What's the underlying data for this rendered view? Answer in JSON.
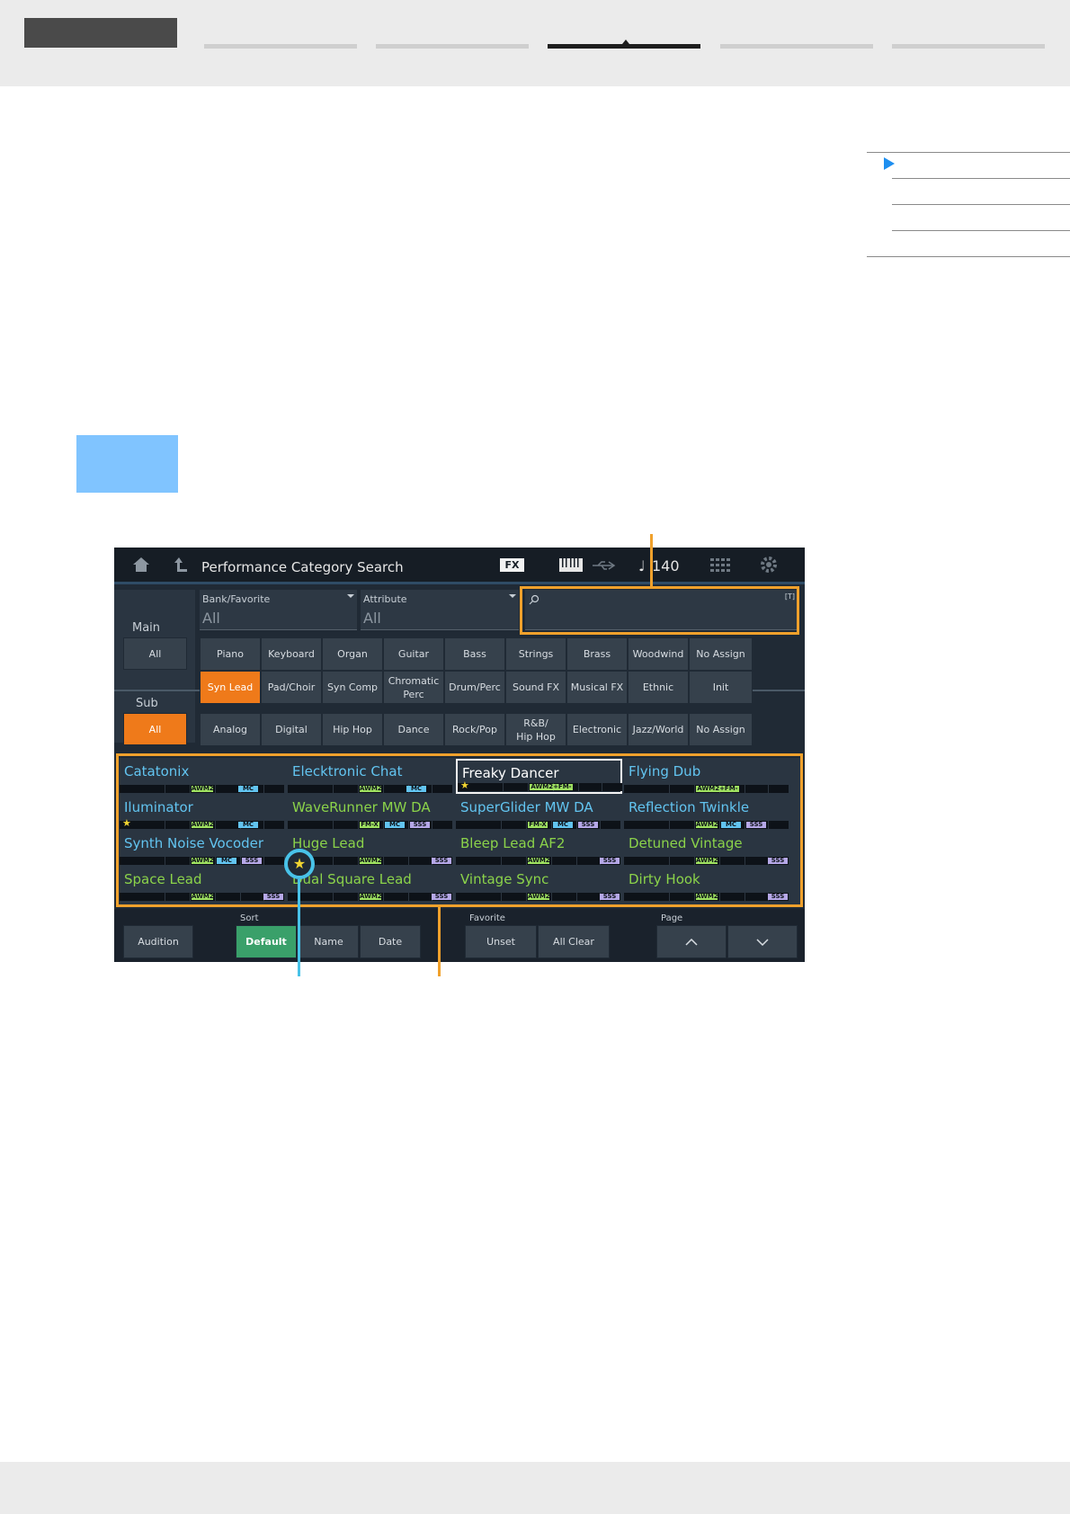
{
  "screen": {
    "title": "Performance Category Search",
    "fx_badge": "FX",
    "tempo": "140",
    "icons": [
      "home-icon",
      "back-icon",
      "keyboard-icon",
      "usb-icon",
      "note-icon",
      "grid-icon",
      "gear-icon",
      "search-icon"
    ],
    "bank_favorite": {
      "label": "Bank/Favorite",
      "value": "All"
    },
    "attribute": {
      "label": "Attribute",
      "value": "All"
    },
    "search_hint": "[T]",
    "main_label": "Main",
    "sub_label": "Sub",
    "main_all": "All",
    "main_row1": [
      "Piano",
      "Keyboard",
      "Organ",
      "Guitar",
      "Bass",
      "Strings",
      "Brass",
      "Woodwind",
      "No Assign"
    ],
    "main_row2": [
      "Syn Lead",
      "Pad/Choir",
      "Syn Comp",
      "Chromatic\nPerc",
      "Drum/Perc",
      "Sound FX",
      "Musical FX",
      "Ethnic",
      "Init"
    ],
    "sub_all": "All",
    "sub_row": [
      "Analog",
      "Digital",
      "Hip Hop",
      "Dance",
      "Rock/Pop",
      "R&B/\nHip Hop",
      "Electronic",
      "Jazz/World",
      "No Assign"
    ],
    "results": [
      {
        "name": "Catatonix",
        "color": "#62c4f0",
        "tags": [
          "AWM2",
          "MC"
        ],
        "star": false
      },
      {
        "name": "Elecktronic Chat",
        "color": "#62c4f0",
        "tags": [
          "AWM2",
          "MC"
        ],
        "star": false
      },
      {
        "name": "Freaky Dancer",
        "color": "#ffffff",
        "tags": [
          "AWM2+FM-X"
        ],
        "star": true
      },
      {
        "name": "Flying Dub",
        "color": "#62c4f0",
        "tags": [
          "AWM2+FM-X"
        ],
        "star": false
      },
      {
        "name": "Iluminator",
        "color": "#62c4f0",
        "tags": [
          "AWM2",
          "MC"
        ],
        "star": true
      },
      {
        "name": "WaveRunner MW DA",
        "color": "#8bd34a",
        "tags": [
          "FM-X",
          "MC",
          "SSS"
        ],
        "star": false
      },
      {
        "name": "SuperGlider MW DA",
        "color": "#62c4f0",
        "tags": [
          "FM-X",
          "MC",
          "SSS"
        ],
        "star": false
      },
      {
        "name": "Reflection Twinkle",
        "color": "#62c4f0",
        "tags": [
          "AWM2",
          "MC",
          "SSS"
        ],
        "star": false
      },
      {
        "name": "Synth Noise Vocoder",
        "color": "#62c4f0",
        "tags": [
          "AWM2",
          "MC",
          "SSS"
        ],
        "star": false
      },
      {
        "name": "Huge Lead",
        "color": "#8bd34a",
        "tags": [
          "AWM2",
          "SSS"
        ],
        "star": false
      },
      {
        "name": "Bleep Lead AF2",
        "color": "#8bd34a",
        "tags": [
          "AWM2",
          "SSS"
        ],
        "star": false
      },
      {
        "name": "Detuned Vintage",
        "color": "#8bd34a",
        "tags": [
          "AWM2",
          "SSS"
        ],
        "star": false
      },
      {
        "name": "Space Lead",
        "color": "#8bd34a",
        "tags": [
          "AWM2",
          "SSS"
        ],
        "star": false
      },
      {
        "name": "Dual Square Lead",
        "color": "#8bd34a",
        "tags": [
          "AWM2",
          "SSS"
        ],
        "star": false
      },
      {
        "name": "Vintage Sync",
        "color": "#8bd34a",
        "tags": [
          "AWM2",
          "SSS"
        ],
        "star": false
      },
      {
        "name": "Dirty Hook",
        "color": "#8bd34a",
        "tags": [
          "AWM2",
          "SSS"
        ],
        "star": false
      }
    ],
    "selected_index": 2,
    "tag_colors": {
      "AWM2": "#9ee060",
      "MC": "#62c4f0",
      "FM-X": "#9ee060",
      "SSS": "#b6a8e8",
      "AWM2+FM-X": "#9ee060"
    },
    "bottom": {
      "audition": "Audition",
      "sort_label": "Sort",
      "sort_default": "Default",
      "sort_name": "Name",
      "sort_date": "Date",
      "favorite_label": "Favorite",
      "unset": "Unset",
      "all_clear": "All Clear",
      "page_label": "Page"
    }
  },
  "colors": {
    "accent_orange": "#ef7a1a",
    "callout_orange": "#f0a12c",
    "callout_blue": "#48c2e8",
    "sort_green": "#3aa06a"
  }
}
